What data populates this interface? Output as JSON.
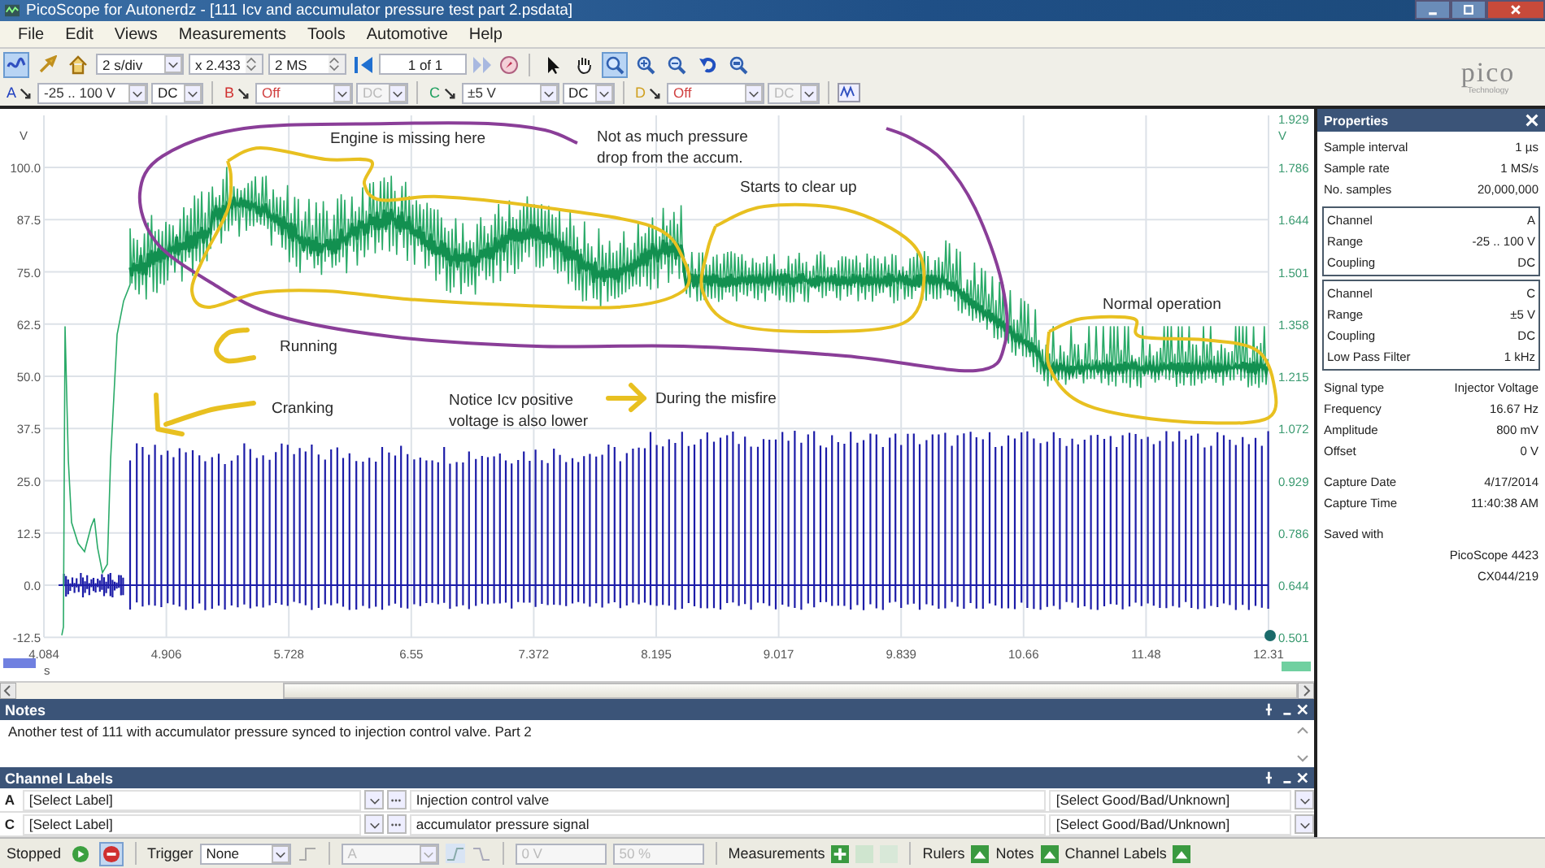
{
  "window": {
    "title": "PicoScope for Autonerdz - [111 Icv and accumulator pressure test part 2.psdata]"
  },
  "menu": [
    "File",
    "Edit",
    "Views",
    "Measurements",
    "Tools",
    "Automotive",
    "Help"
  ],
  "logo": {
    "name": "pico",
    "tagline": "Technology"
  },
  "toolbar": {
    "modes": [
      {
        "kind": "scope",
        "selected": true
      },
      {
        "kind": "probe",
        "selected": false
      },
      {
        "kind": "home",
        "selected": false
      }
    ],
    "timebase": "2 s/div",
    "zoom": "x 2.433",
    "samples": "2 MS",
    "page": "1 of 1",
    "tools": [
      {
        "kind": "pointer",
        "selected": false
      },
      {
        "kind": "hand",
        "selected": false
      },
      {
        "kind": "zoom-box",
        "selected": true
      },
      {
        "kind": "zoom-in",
        "selected": false
      },
      {
        "kind": "zoom-out",
        "selected": false
      },
      {
        "kind": "undo",
        "selected": false
      },
      {
        "kind": "zoom-fit",
        "selected": false
      }
    ]
  },
  "channels": [
    {
      "letter": "A",
      "color": "#2040c0",
      "range": "-25 .. 100 V",
      "coupling": "DC",
      "disabled": false
    },
    {
      "letter": "B",
      "color": "#d03030",
      "range": "Off",
      "coupling": "DC",
      "disabled": true
    },
    {
      "letter": "C",
      "color": "#20a060",
      "range": "±5 V",
      "coupling": "DC",
      "disabled": false
    },
    {
      "letter": "D",
      "color": "#d0a020",
      "range": "Off",
      "coupling": "DC",
      "disabled": true
    }
  ],
  "plot": {
    "y_unit": "V",
    "y_ticks": [
      "100.0",
      "87.5",
      "75.0",
      "62.5",
      "50.0",
      "37.5",
      "25.0",
      "12.5",
      "0.0",
      "-12.5"
    ],
    "y2_unit": "V",
    "y2_ticks": [
      "1.929",
      "1.786",
      "1.644",
      "1.501",
      "1.358",
      "1.215",
      "1.072",
      "0.929",
      "0.786",
      "0.644",
      "0.501"
    ],
    "x_ticks": [
      "4.084",
      "4.906",
      "5.728",
      "6.55",
      "7.372",
      "8.195",
      "9.017",
      "9.839",
      "10.66",
      "11.48",
      "12.31"
    ],
    "x_unit": "s",
    "annotations": [
      {
        "lines": [
          "Engine is missing here"
        ]
      },
      {
        "lines": [
          "Not as much pressure",
          "drop from the accum."
        ]
      },
      {
        "lines": [
          "Starts to clear up"
        ]
      },
      {
        "lines": [
          "Running"
        ]
      },
      {
        "lines": [
          "Cranking"
        ]
      },
      {
        "lines": [
          "Notice Icv positive",
          "voltage is also lower"
        ]
      },
      {
        "lines": [
          "During the misfire"
        ]
      },
      {
        "lines": [
          "Normal operation"
        ]
      }
    ]
  },
  "notes": {
    "title": "Notes",
    "text": "Another test of 111 with accumulator pressure synced to injection control valve. Part 2"
  },
  "channel_labels": {
    "title": "Channel Labels",
    "rows": [
      {
        "channel": "A",
        "label": "[Select Label]",
        "description": "Injection control valve",
        "status": "[Select Good/Bad/Unknown]"
      },
      {
        "channel": "C",
        "label": "[Select Label]",
        "description": "accumulator pressure signal",
        "status": "[Select Good/Bad/Unknown]"
      }
    ]
  },
  "properties": {
    "title": "Properties",
    "sections": [
      {
        "kind": "plain",
        "rows": [
          {
            "label": "Sample interval",
            "value": "1 µs"
          },
          {
            "label": "Sample rate",
            "value": "1 MS/s"
          },
          {
            "label": "No. samples",
            "value": "20,000,000"
          }
        ]
      },
      {
        "kind": "boxed",
        "rows": [
          {
            "label": "Channel",
            "value": "A"
          },
          {
            "label": "Range",
            "value": "-25 .. 100 V"
          },
          {
            "label": "Coupling",
            "value": "DC"
          }
        ]
      },
      {
        "kind": "boxed",
        "rows": [
          {
            "label": "Channel",
            "value": "C"
          },
          {
            "label": "Range",
            "value": "±5 V"
          },
          {
            "label": "Coupling",
            "value": "DC"
          },
          {
            "label": "Low Pass Filter",
            "value": "1 kHz"
          }
        ]
      },
      {
        "kind": "plain",
        "rows": [
          {
            "label": "Signal type",
            "value": "Injector Voltage"
          },
          {
            "label": "Frequency",
            "value": "16.67 Hz"
          },
          {
            "label": "Amplitude",
            "value": "800 mV"
          },
          {
            "label": "Offset",
            "value": "0 V"
          }
        ]
      },
      {
        "kind": "plain",
        "rows": [
          {
            "label": "Capture Date",
            "value": "4/17/2014"
          },
          {
            "label": "Capture Time",
            "value": "11:40:38 AM"
          }
        ]
      },
      {
        "kind": "saved",
        "label": "Saved with",
        "lines": [
          "PicoScope 4423",
          "CX044/219"
        ]
      }
    ]
  },
  "status_bar": {
    "state": "Stopped",
    "stop_pressed": true,
    "trigger_label": "Trigger",
    "trigger_mode": "None",
    "trigger_source": "A",
    "trigger_level": "0 V",
    "pretrigger": "50 %",
    "panels": [
      "Measurements",
      "Rulers",
      "Notes",
      "Channel Labels"
    ]
  }
}
